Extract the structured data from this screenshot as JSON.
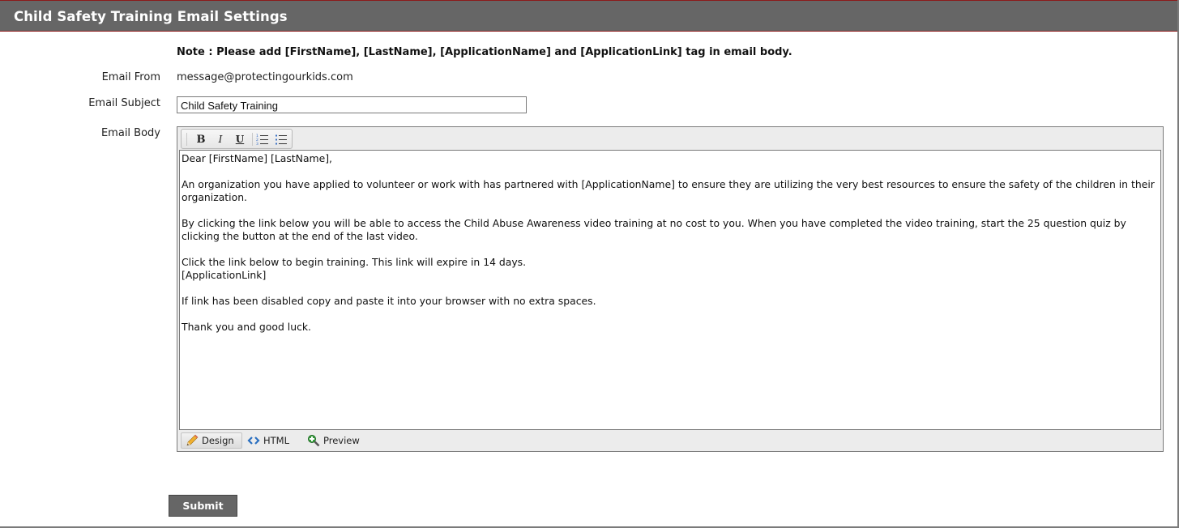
{
  "header": {
    "title": "Child Safety Training Email Settings"
  },
  "note": "Note : Please add [FirstName], [LastName], [ApplicationName] and [ApplicationLink] tag in email body.",
  "form": {
    "email_from": {
      "label": "Email From",
      "value": "message@protectingourkids.com"
    },
    "email_subject": {
      "label": "Email Subject",
      "value": "Child Safety Training"
    },
    "email_body": {
      "label": "Email Body",
      "toolbar": {
        "bold": {
          "label": "B",
          "icon": "bold-icon"
        },
        "italic": {
          "label": "I",
          "icon": "italic-icon"
        },
        "underline": {
          "label": "U",
          "icon": "underline-icon"
        },
        "ordered_list": {
          "icon": "ordered-list-icon"
        },
        "unordered_list": {
          "icon": "unordered-list-icon"
        }
      },
      "paragraphs": [
        "Dear [FirstName] [LastName],",
        "An organization you have applied to volunteer or work with has partnered with [ApplicationName] to ensure they are utilizing the very best resources to ensure the safety of the children in their organization.",
        "By clicking the link below you will be able to access the Child Abuse Awareness video training at no cost to you. When you have completed the video training, start the 25 question quiz by clicking the button at the end of the last video.",
        "Click the link below to begin training. This link will expire in 14 days.\n[ApplicationLink]",
        "If link has been disabled copy and paste it into your browser with no extra spaces.",
        "Thank you and good luck."
      ],
      "modes": [
        {
          "label": "Design",
          "icon": "pencil-icon",
          "active": true
        },
        {
          "label": "HTML",
          "icon": "code-icon",
          "active": false
        },
        {
          "label": "Preview",
          "icon": "magnifier-icon",
          "active": false
        }
      ]
    }
  },
  "submit_label": "Submit",
  "colors": {
    "header_bg": "#666666",
    "header_border": "#8b1a1a",
    "button_bg": "#666666",
    "editor_bg": "#ececec"
  }
}
